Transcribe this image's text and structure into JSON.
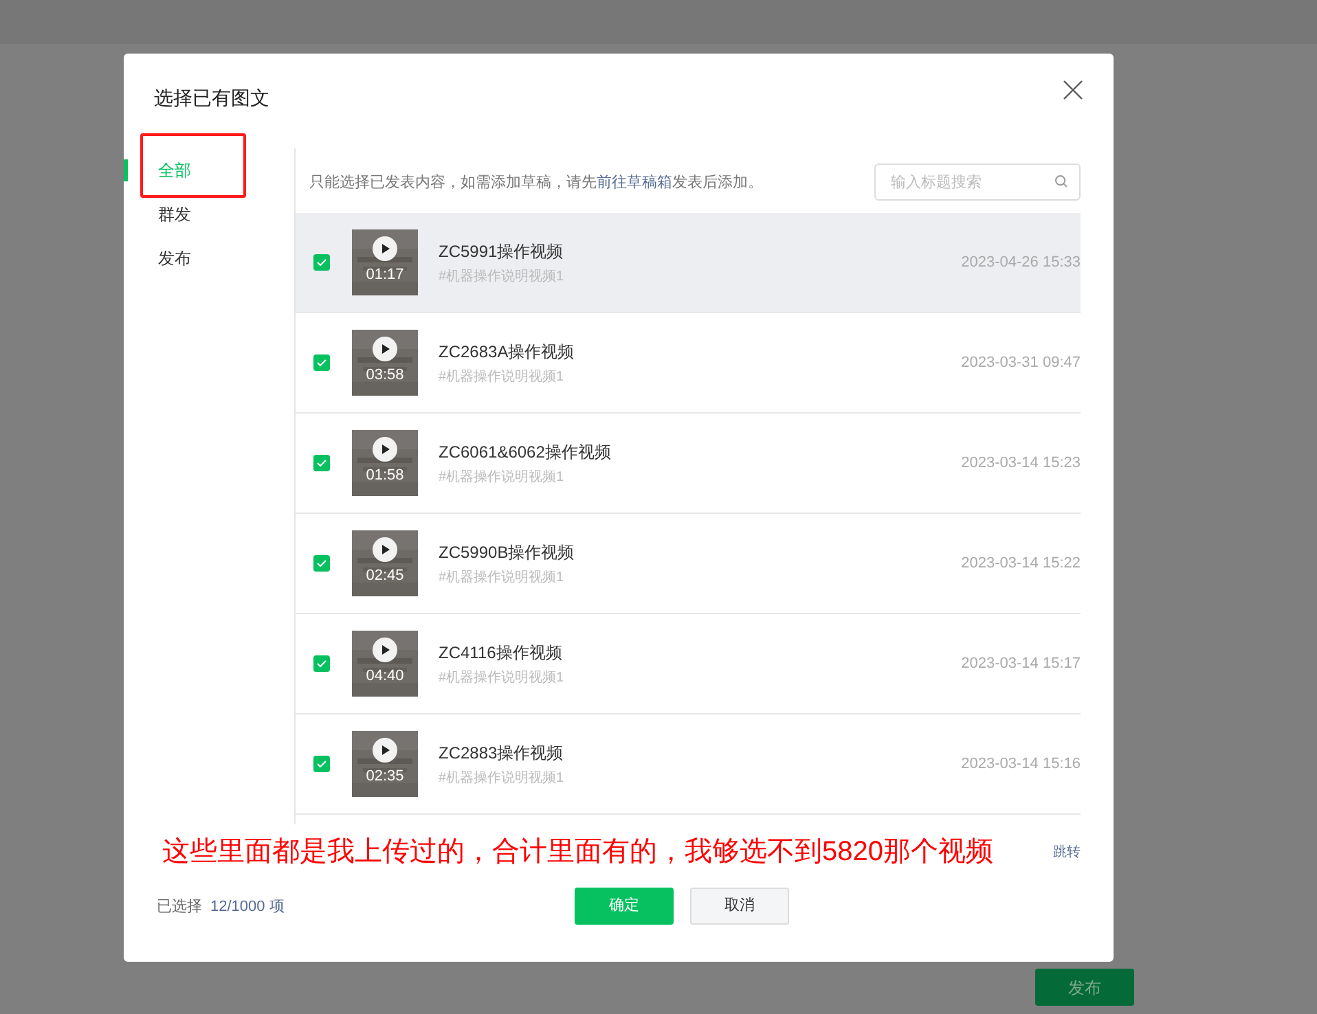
{
  "dialog": {
    "title": "选择已有图文"
  },
  "sidebar": {
    "items": [
      {
        "label": "全部",
        "selected": true
      },
      {
        "label": "群发",
        "selected": false
      },
      {
        "label": "发布",
        "selected": false
      }
    ]
  },
  "hint": {
    "before": "只能选择已发表内容，如需添加草稿，请先",
    "link": "前往草稿箱",
    "after": "发表后添加。"
  },
  "search": {
    "placeholder": "输入标题搜索"
  },
  "rows": [
    {
      "checked": true,
      "highlighted": true,
      "title": "ZC5991操作视频",
      "tag": "#机器操作说明视频1",
      "duration": "01:17",
      "date": "2023-04-26 15:33"
    },
    {
      "checked": true,
      "highlighted": false,
      "title": "ZC2683A操作视频",
      "tag": "#机器操作说明视频1",
      "duration": "03:58",
      "date": "2023-03-31 09:47"
    },
    {
      "checked": true,
      "highlighted": false,
      "title": "ZC6061&6062操作视频",
      "tag": "#机器操作说明视频1",
      "duration": "01:58",
      "date": "2023-03-14 15:23"
    },
    {
      "checked": true,
      "highlighted": false,
      "title": "ZC5990B操作视频",
      "tag": "#机器操作说明视频1",
      "duration": "02:45",
      "date": "2023-03-14 15:22"
    },
    {
      "checked": true,
      "highlighted": false,
      "title": "ZC4116操作视频",
      "tag": "#机器操作说明视频1",
      "duration": "04:40",
      "date": "2023-03-14 15:17"
    },
    {
      "checked": true,
      "highlighted": false,
      "title": "ZC2883操作视频",
      "tag": "#机器操作说明视频1",
      "duration": "02:35",
      "date": "2023-03-14 15:16"
    }
  ],
  "pagination": {
    "jump": "跳转"
  },
  "annotation": {
    "text": "这些里面都是我上传过的，合计里面有的，我够选不到5820那个视频"
  },
  "footer": {
    "selected_label": "已选择",
    "selected_count": "12/1000 项",
    "buttons": [
      {
        "label": "确定",
        "kind": "primary"
      },
      {
        "label": "取消",
        "kind": "secondary"
      }
    ]
  },
  "page": {
    "publish_button": "发布"
  }
}
